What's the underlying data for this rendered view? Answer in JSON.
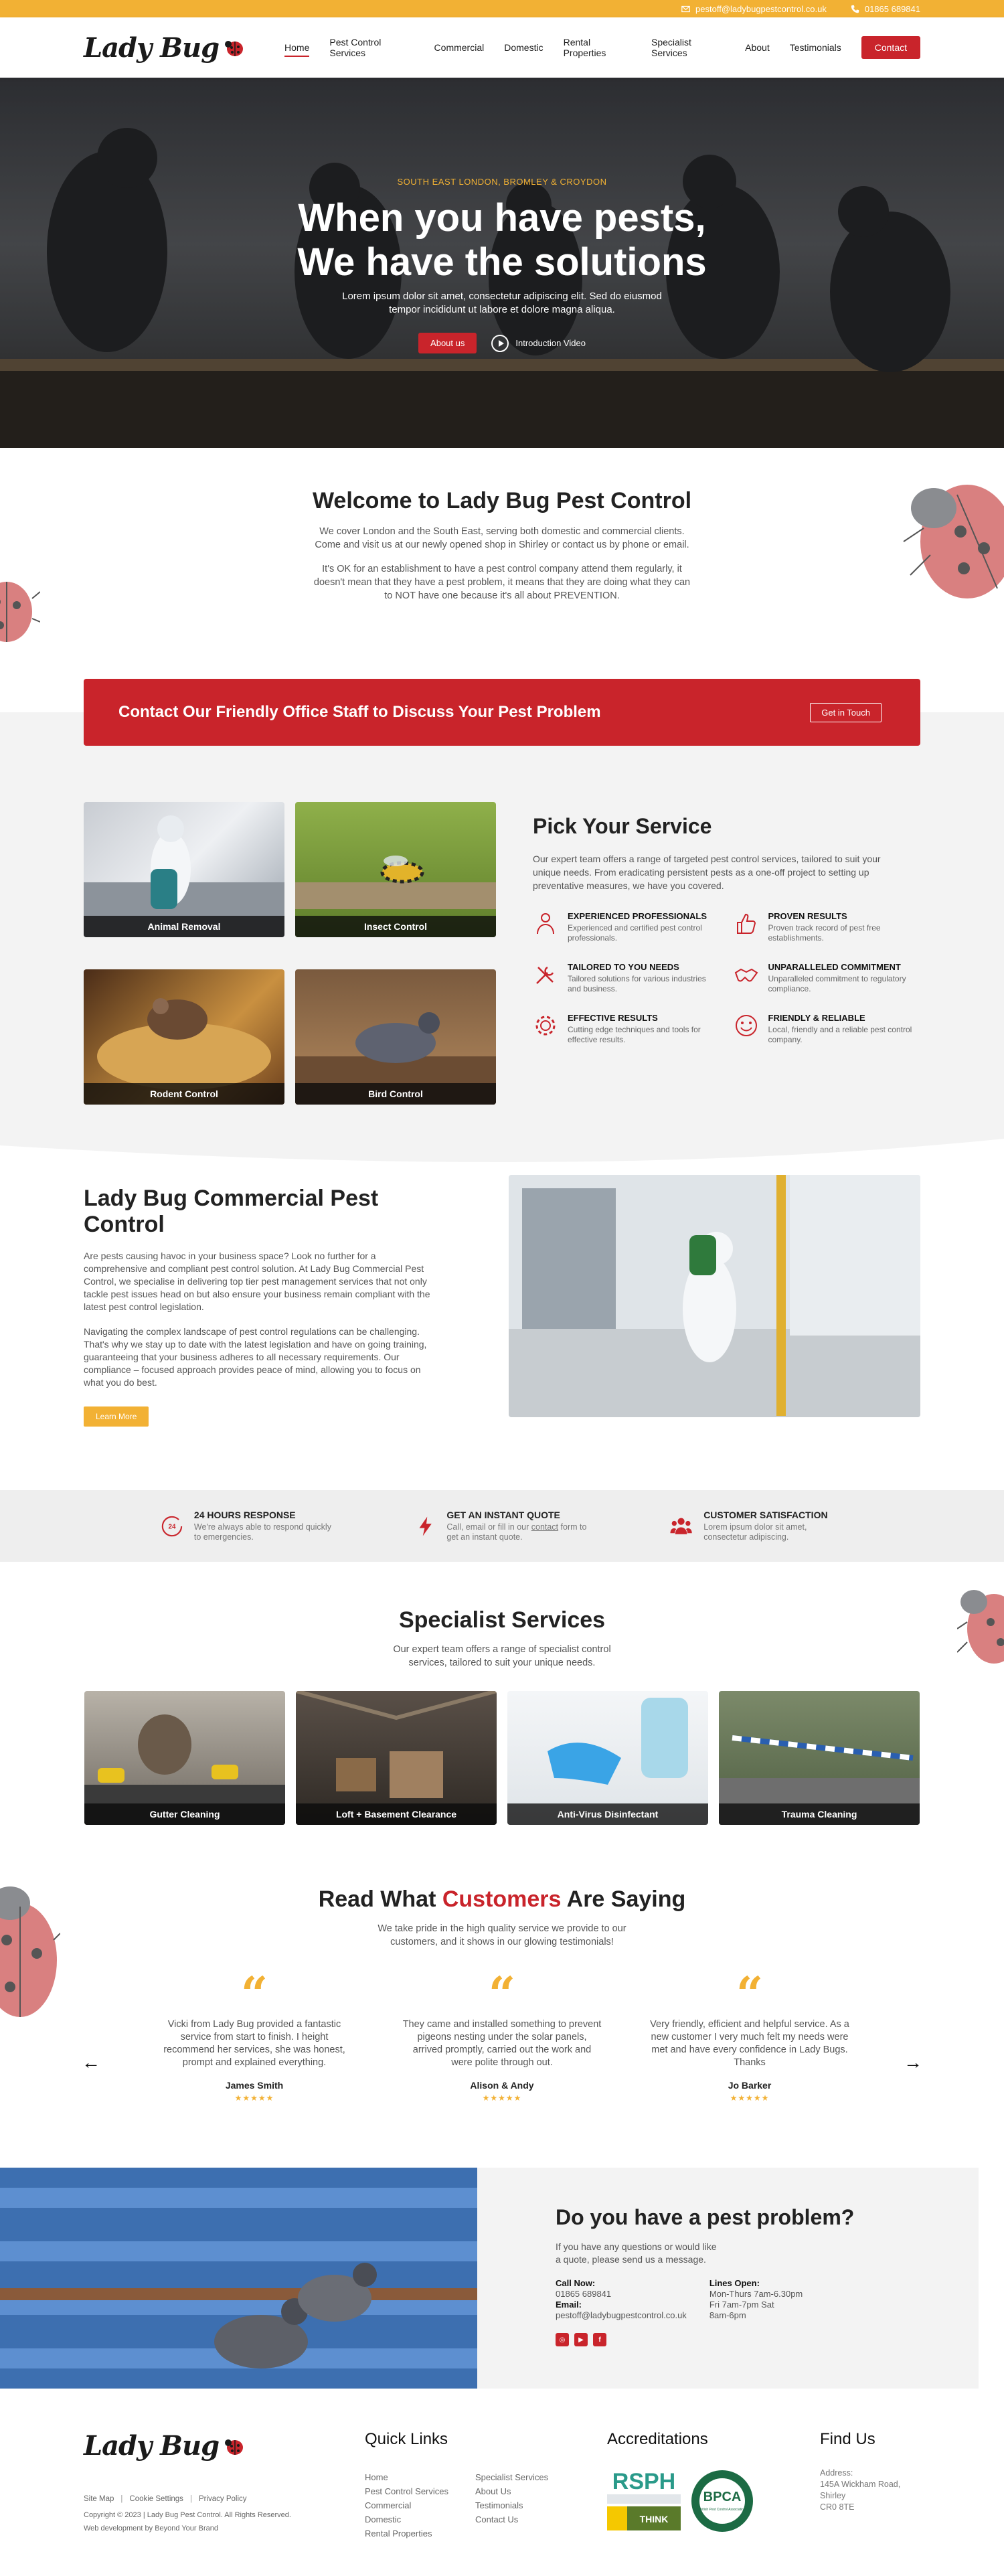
{
  "topbar": {
    "email": "pestoff@ladybugpestcontrol.co.uk",
    "phone": "01865 689841"
  },
  "brand": {
    "name": "Lady Bug",
    "colors": {
      "red": "#c9242b",
      "yellow": "#f2b134"
    }
  },
  "nav": {
    "items": [
      {
        "label": "Home",
        "active": true
      },
      {
        "label": "Pest Control Services"
      },
      {
        "label": "Commercial"
      },
      {
        "label": "Domestic"
      },
      {
        "label": "Rental Properties"
      },
      {
        "label": "Specialist Services"
      },
      {
        "label": "About"
      },
      {
        "label": "Testimonials"
      }
    ],
    "contact_label": "Contact"
  },
  "hero": {
    "eyebrow": "SOUTH EAST LONDON, BROMLEY & CROYDON",
    "title_line1": "When you have pests,",
    "title_line2": "We have the solutions",
    "subtitle_line1": "Lorem ipsum dolor sit amet, consectetur adipiscing elit. Sed do eiusmod",
    "subtitle_line2": "tempor incididunt ut labore et dolore magna aliqua.",
    "about_label": "About us",
    "video_label": "Introduction Video"
  },
  "welcome": {
    "title": "Welcome to Lady Bug Pest Control",
    "para1": "We cover London and the South East, serving both domestic and commercial clients. Come and visit us at our newly opened shop in Shirley or contact us by phone or email.",
    "para2": "It's OK for an establishment to have a pest control company attend them regularly, it doesn't mean that they have a pest problem, it means that they are doing what they can to NOT have one because it's all about PREVENTION."
  },
  "cta": {
    "text": "Contact Our Friendly Office Staff to Discuss Your Pest Problem",
    "button": "Get in Touch"
  },
  "services": {
    "tiles": [
      "Animal Removal",
      "Insect Control",
      "Rodent Control",
      "Bird Control"
    ],
    "title": "Pick Your Service",
    "intro": "Our expert team offers a range of targeted pest control services, tailored to suit your unique needs. From eradicating persistent pests as a one-off project to setting up preventative measures, we have you covered.",
    "features": [
      {
        "title": "EXPERIENCED PROFESSIONALS",
        "desc": "Experienced and certified pest control professionals.",
        "icon": "person-icon"
      },
      {
        "title": "PROVEN RESULTS",
        "desc": "Proven track record of pest free establishments.",
        "icon": "thumbs-up-icon"
      },
      {
        "title": "TAILORED TO YOU NEEDS",
        "desc": "Tailored solutions for various industries and business.",
        "icon": "tools-icon"
      },
      {
        "title": "UNPARALLELED COMMITMENT",
        "desc": "Unparalleled commitment to regulatory compliance.",
        "icon": "handshake-icon"
      },
      {
        "title": "EFFECTIVE RESULTS",
        "desc": "Cutting edge techniques and tools for effective results.",
        "icon": "gear-icon"
      },
      {
        "title": "FRIENDLY & RELIABLE",
        "desc": "Local, friendly and a reliable pest control company.",
        "icon": "smile-icon"
      }
    ]
  },
  "commercial": {
    "title": "Lady Bug Commercial Pest Control",
    "para1": "Are pests causing havoc in your business space? Look no further for a comprehensive and compliant pest control solution. At Lady Bug Commercial Pest Control, we specialise in delivering top tier pest management services that not only tackle pest issues head on but also ensure your business remain compliant with the latest pest control legislation.",
    "para2": "Navigating the complex landscape of pest control regulations can be challenging. That's why we stay up to date with the latest legislation and have on going training, guaranteeing that your business adheres to all necessary requirements. Our compliance – focused approach provides peace of mind, allowing you to focus on what you do best.",
    "button": "Learn More"
  },
  "stats": [
    {
      "title": "24 HOURS RESPONSE",
      "desc": "We're always able to respond quickly to emergencies.",
      "icon": "clock-24-icon"
    },
    {
      "title": "GET AN INSTANT QUOTE",
      "desc_prefix": "Call, email or fill in our ",
      "desc_link": "contact",
      "desc_suffix": " form to get an instant quote.",
      "icon": "lightning-icon"
    },
    {
      "title": "CUSTOMER SATISFACTION",
      "desc": "Lorem ipsum dolor sit amet, consectetur adipiscing.",
      "icon": "people-icon"
    }
  ],
  "specialist": {
    "title": "Specialist Services",
    "intro": "Our expert team offers a range of specialist control services, tailored to suit your unique needs.",
    "tiles": [
      "Gutter Cleaning",
      "Loft + Basement Clearance",
      "Anti-Virus Disinfectant",
      "Trauma Cleaning"
    ]
  },
  "testimonials": {
    "title_pre": "Read What ",
    "title_hl": "Customers",
    "title_post": " Are Saying",
    "intro": "We take pride in the high quality service we provide to our customers, and it shows in our glowing testimonials!",
    "items": [
      {
        "text": "Vicki from Lady Bug provided a fantastic service from start to finish. I height recommend her services, she was honest, prompt and explained everything.",
        "name": "James Smith",
        "stars": "★★★★★"
      },
      {
        "text": "They came and installed something to prevent pigeons nesting under the solar panels, arrived promptly, carried out the work and were polite through out.",
        "name": "Alison & Andy",
        "stars": "★★★★★"
      },
      {
        "text": "Very friendly, efficient and helpful service. As a new customer I very much felt my needs were met and have every confidence in Lady Bugs. Thanks",
        "name": "Jo Barker",
        "stars": "★★★★★"
      }
    ]
  },
  "contact": {
    "title": "Do you have a pest problem?",
    "intro": "If you have any questions or would like a quote, please send us a message.",
    "call_label": "Call Now:",
    "call_value": "01865 689841",
    "email_label": "Email:",
    "email_value": "pestoff@ladybugpestcontrol.co.uk",
    "hours_label": "Lines Open:",
    "hours_1": "Mon-Thurs 7am-6.30pm",
    "hours_2": "Fri 7am-7pm Sat",
    "hours_3": "8am-6pm",
    "socials": [
      "Instagram",
      "YouTube",
      "Facebook"
    ]
  },
  "footer": {
    "links": [
      "Site Map",
      "Cookie Settings",
      "Privacy Policy"
    ],
    "copyright": "Copyright © 2023 | Lady Bug Pest Control. All Rights Reserved.",
    "credit": "Web development by Beyond Your Brand",
    "quick_title": "Quick Links",
    "quick_col1": [
      "Home",
      "Pest Control Services",
      "Commercial",
      "Domestic",
      "Rental Properties"
    ],
    "quick_col2": [
      "Specialist Services",
      "About Us",
      "Testimonials",
      "Contact Us"
    ],
    "accr_title": "Accreditations",
    "rsph": "RSPH",
    "rsph_think": "THINK",
    "bpca": "BPCA",
    "bpca_sub": "British Pest Control Association",
    "find_title": "Find Us",
    "address_label": "Address:",
    "address_1": "145A Wickham Road,",
    "address_2": "Shirley",
    "address_3": "CR0 8TE"
  }
}
